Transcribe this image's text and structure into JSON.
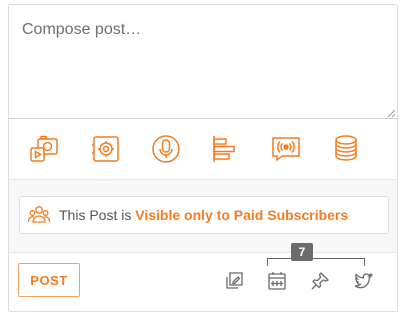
{
  "compose": {
    "placeholder": "Compose post…"
  },
  "toolbar": {
    "items": [
      {
        "icon": "photo-video-icon"
      },
      {
        "icon": "vault-icon"
      },
      {
        "icon": "microphone-icon"
      },
      {
        "icon": "poll-icon"
      },
      {
        "icon": "live-broadcast-icon"
      },
      {
        "icon": "coins-icon"
      }
    ]
  },
  "visibility": {
    "prefix": "This Post is ",
    "link_label": "Visible only to Paid Subscribers",
    "icon": "users-icon"
  },
  "footer": {
    "post_label": "POST",
    "count_badge": "7",
    "icons": [
      "queue-icon",
      "calendar-icon",
      "pin-icon",
      "twitter-icon"
    ]
  },
  "colors": {
    "accent": "#f47c20",
    "badge": "#6b6b6b"
  }
}
